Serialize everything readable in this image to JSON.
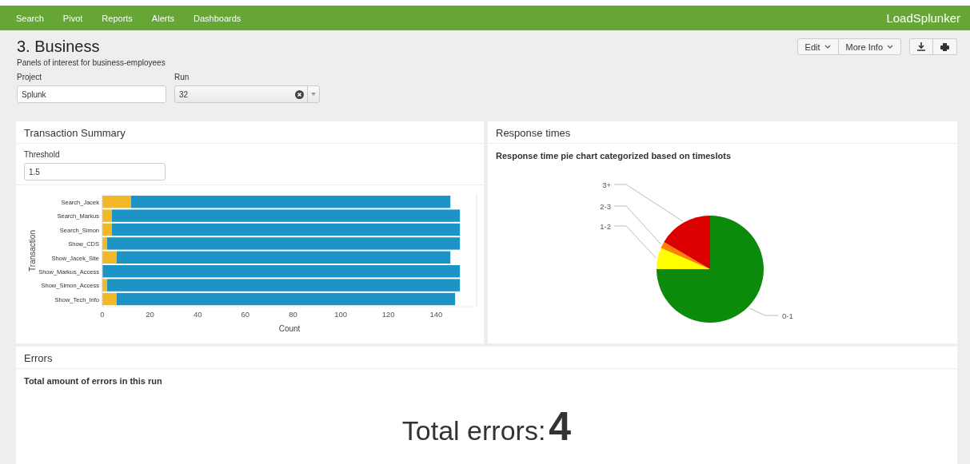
{
  "nav": {
    "items": [
      {
        "label": "Search"
      },
      {
        "label": "Pivot"
      },
      {
        "label": "Reports"
      },
      {
        "label": "Alerts"
      },
      {
        "label": "Dashboards"
      }
    ],
    "brand": "LoadSplunker"
  },
  "header": {
    "title": "3. Business",
    "description": "Panels of interest for business-employees",
    "buttons": [
      {
        "label": "Edit"
      },
      {
        "label": "More Info"
      }
    ]
  },
  "inputs": [
    {
      "kind": "text",
      "label": "Project",
      "value": "Splunk"
    },
    {
      "kind": "select",
      "label": "Run",
      "value": "32"
    }
  ],
  "panels": [
    {
      "kind": "bar",
      "title": "Transaction Summary",
      "threshold": {
        "label": "Threshold",
        "value": "1.5"
      },
      "chart_data": {
        "type": "bar",
        "orientation": "horizontal",
        "stacked": true,
        "xlabel": "Count",
        "ylabel": "Transaction",
        "categories": [
          "Search_Jacek",
          "Search_Markus",
          "Search_Simon",
          "Show_CDS",
          "Show_Jacek_Site",
          "Show_Markus_Access",
          "Show_Simon_Access",
          "Show_Tech_Info"
        ],
        "series": [
          {
            "color": "#f2b827",
            "values": [
              12,
              4,
              4,
              2,
              6,
              0,
              2,
              6
            ]
          },
          {
            "color": "#1e93c6",
            "values": [
              134,
              146,
              146,
              148,
              140,
              150,
              148,
              142
            ]
          }
        ],
        "xlim": [
          0,
          157
        ],
        "xticks": [
          0,
          20,
          40,
          60,
          80,
          100,
          120,
          140
        ]
      }
    },
    {
      "kind": "pie",
      "title": "Response times",
      "subtitle": "Response time pie chart categorized based on timeslots",
      "chart_data": {
        "type": "pie",
        "categories": [
          "0-1",
          "1-2",
          "2-3",
          "3+"
        ],
        "values": [
          75,
          6.5,
          2,
          16.5
        ],
        "colors": [
          "#0b8a0b",
          "#ffff00",
          "#ff7f00",
          "#dd0000"
        ]
      }
    }
  ],
  "errors": {
    "title": "Errors",
    "subtitle": "Total amount of errors in this run",
    "label": "Total errors:",
    "value": "4"
  }
}
